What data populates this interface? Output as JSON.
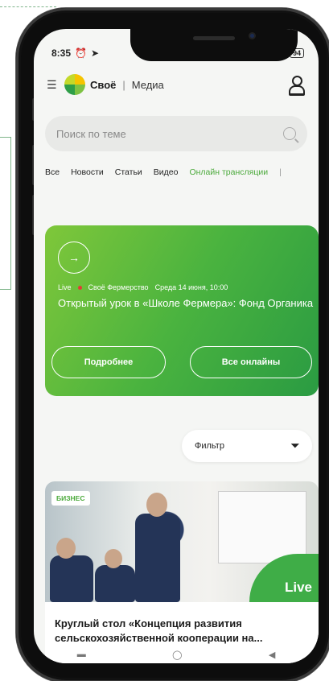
{
  "status_bar": {
    "time": "8:35",
    "battery": "94"
  },
  "header": {
    "brand": "Своё",
    "separator": "|",
    "section": "Медиа"
  },
  "search": {
    "placeholder": "Поиск по теме"
  },
  "tabs": [
    {
      "label": "Все",
      "active": false
    },
    {
      "label": "Новости",
      "active": false
    },
    {
      "label": "Статьи",
      "active": false
    },
    {
      "label": "Видео",
      "active": false
    },
    {
      "label": "Онлайн трансляции",
      "active": true
    }
  ],
  "hero": {
    "live_label": "Live",
    "source": "Своё Фермерство",
    "date": "Среда 14 июня, 10:00",
    "title": "Открытый урок в «Школе Фермера»: Фонд Органика",
    "more_button": "Подробнее",
    "all_button": "Все онлайны"
  },
  "filter": {
    "label": "Фильтр"
  },
  "article": {
    "category": "БИЗНЕС",
    "live_badge": "Live",
    "title": "Круглый стол «Концепция развития сельскохозяйственной кооперации на..."
  },
  "colors": {
    "accent": "#4caa3c",
    "live_dot": "#e53935"
  },
  "icons": [
    "menu-icon",
    "user-icon",
    "search-icon",
    "arrow-right-icon",
    "filter-icon",
    "alarm-icon",
    "location-icon"
  ]
}
